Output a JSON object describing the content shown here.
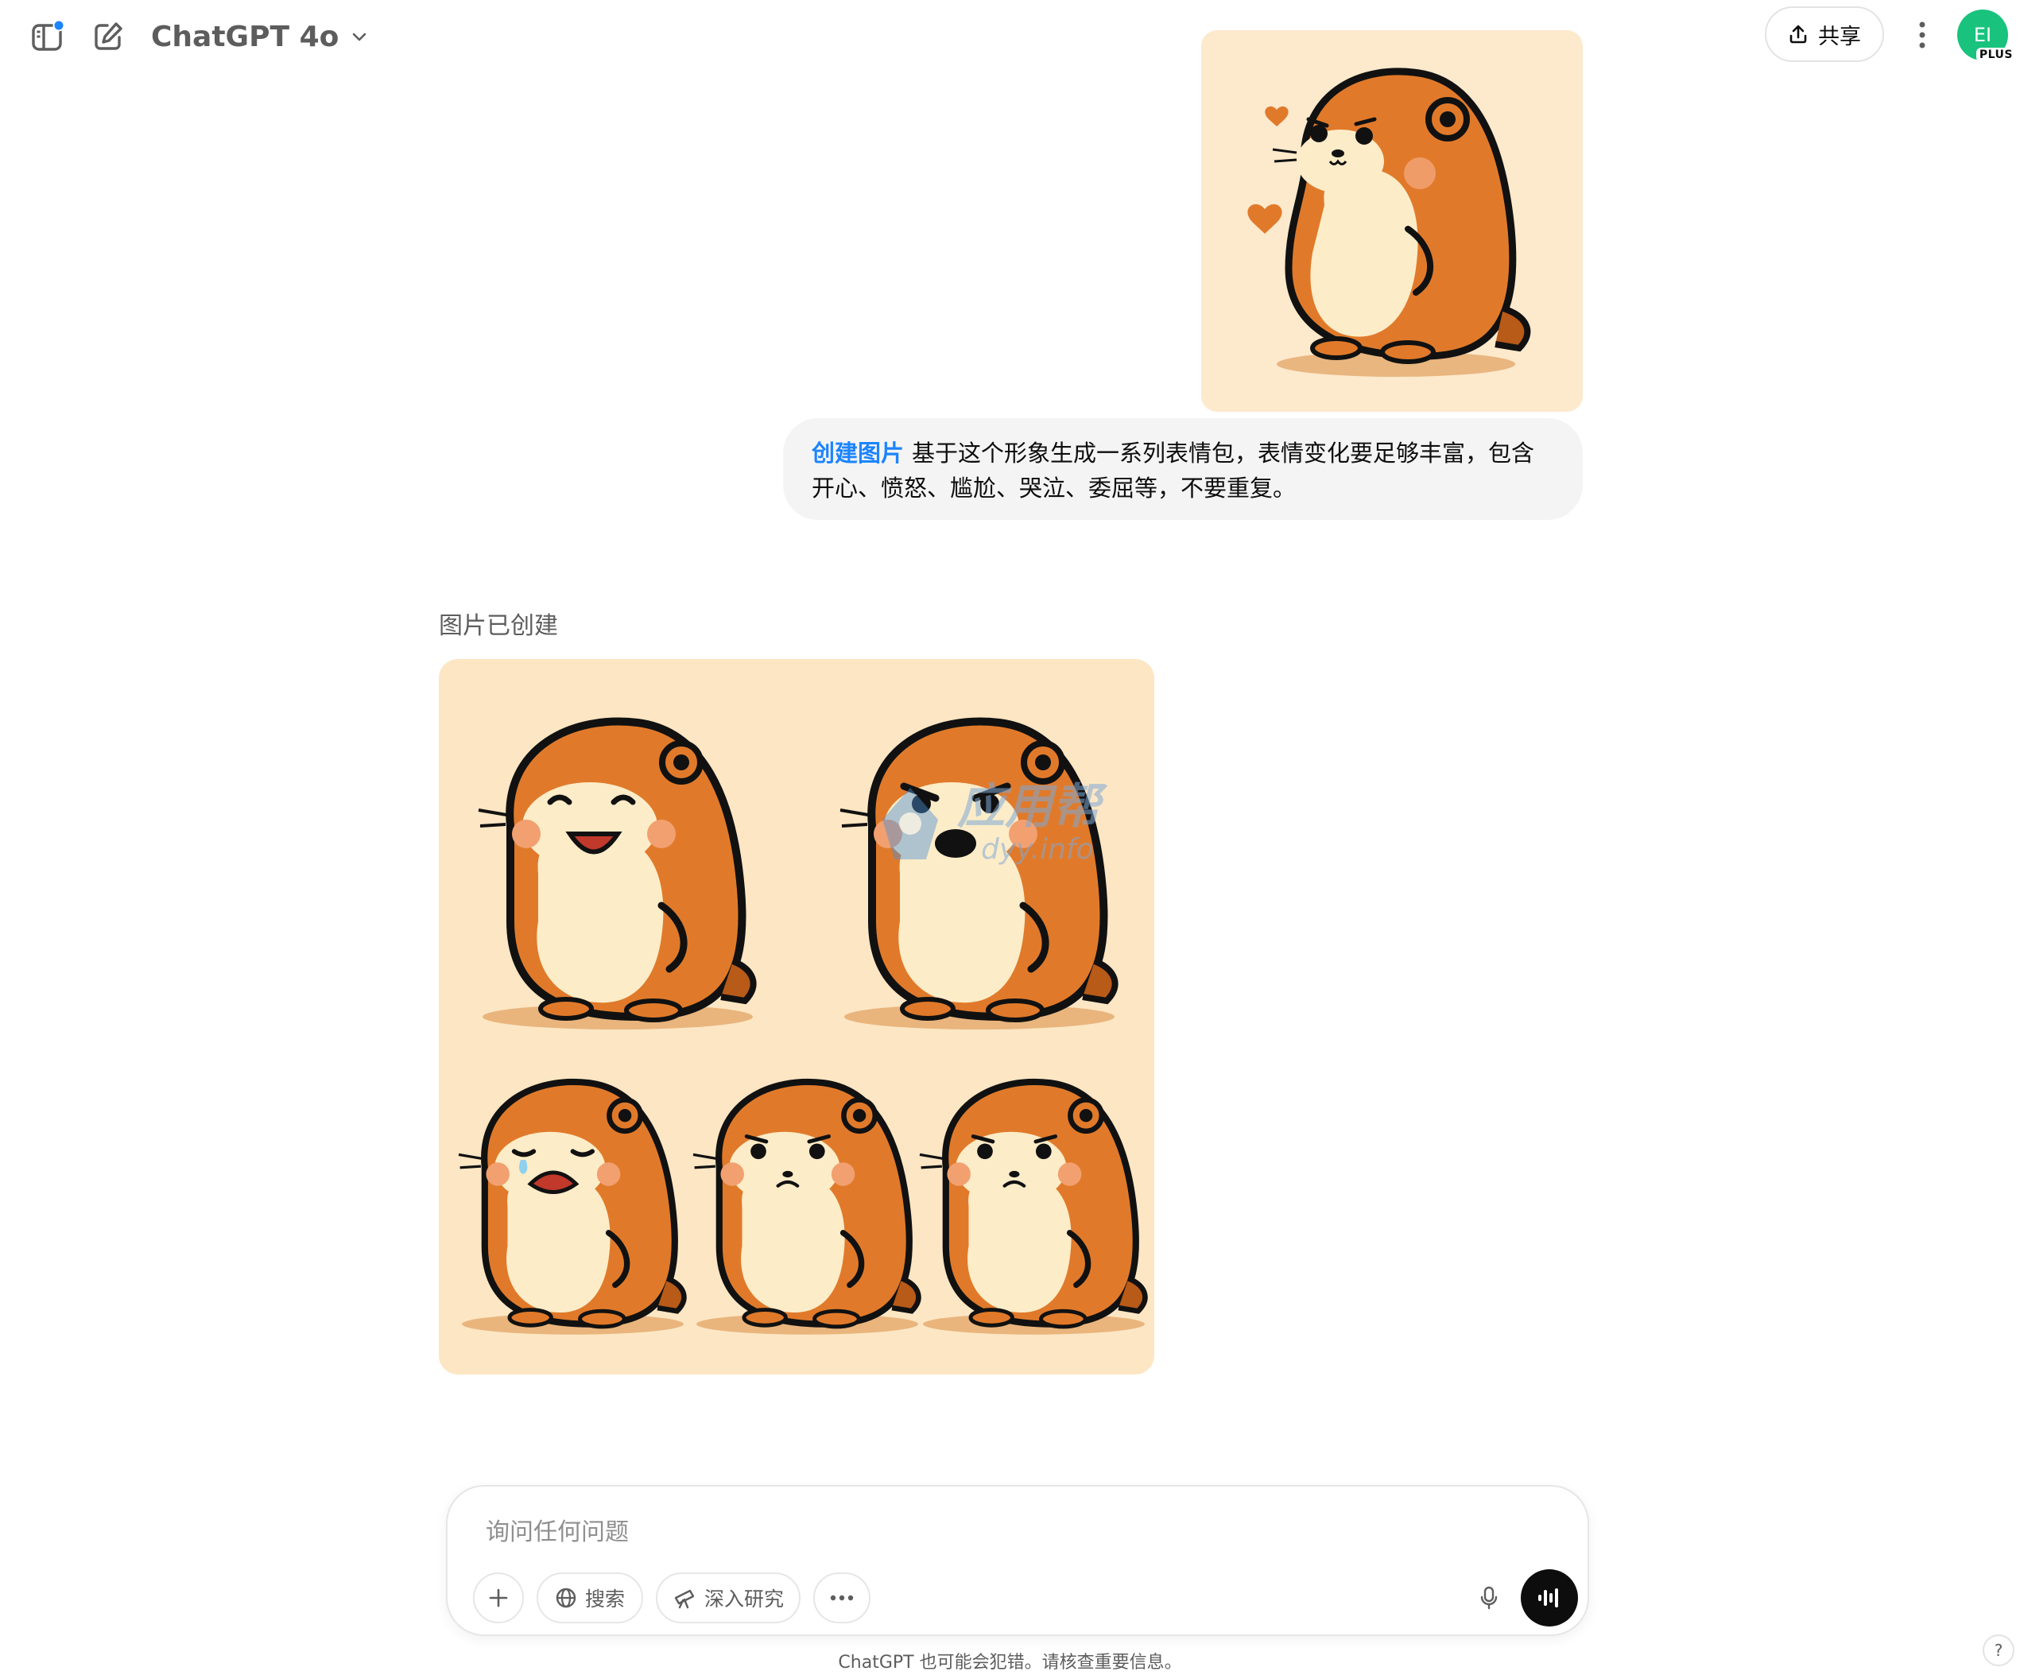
{
  "header": {
    "sidebar_icon": "sidebar-toggle-icon",
    "new_chat_icon": "edit-pencil-icon",
    "model_name": "ChatGPT 4o",
    "share_label": "共享",
    "avatar_initials": "EI",
    "avatar_badge": "PLUS",
    "avatar_color": "#19c37d",
    "notification_dot_color": "#1c84ff"
  },
  "user_message": {
    "image_subject": "otter-character-image",
    "tool_tag": "创建图片",
    "text": "基于这个形象生成一系列表情包，表情变化要足够丰富，包含开心、愤怒、尴尬、哭泣、委屈等，不要重复。"
  },
  "assistant_message": {
    "status": "图片已创建",
    "image_subject": "otter-sticker-sheet-image",
    "expressions": [
      "happy",
      "angry",
      "crying",
      "awkward",
      "wronged"
    ],
    "watermark_main": "应用帮",
    "watermark_sub": "dyy.info"
  },
  "composer": {
    "placeholder": "询问任何问题",
    "value": "",
    "search_label": "搜索",
    "research_label": "深入研究",
    "plus_icon": "plus-icon",
    "globe_icon": "globe-icon",
    "telescope_icon": "telescope-icon",
    "more_icon": "ellipsis-icon",
    "mic_icon": "microphone-icon",
    "voice_icon": "voice-waveform-icon"
  },
  "footer": {
    "disclaimer": "ChatGPT 也可能会犯错。请核查重要信息。",
    "help_label": "?"
  },
  "colors": {
    "accent": "#1c84ff",
    "otter_orange": "#e07a2a",
    "otter_belly": "#fdecc8",
    "image_background": "#fde6c3"
  }
}
